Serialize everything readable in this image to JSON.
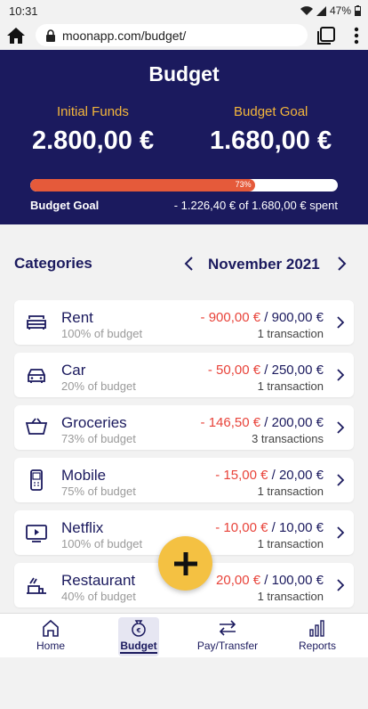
{
  "status": {
    "time": "10:31",
    "battery": "47%"
  },
  "browser": {
    "url": "moonapp.com/budget/"
  },
  "header": {
    "title": "Budget",
    "initial_funds_label": "Initial Funds",
    "initial_funds_value": "2.800,00 €",
    "budget_goal_label": "Budget Goal",
    "budget_goal_value": "1.680,00 €",
    "progress_fraction": 0.73,
    "progress_text": "73%",
    "goal_row_label": "Budget Goal",
    "goal_row_spent": "- 1.226,40 € of 1.680,00 € spent",
    "accent_color": "#f4b63b",
    "bar_color": "#e55a3a",
    "bg_color": "#1b1a5e"
  },
  "categories_section": {
    "heading": "Categories",
    "month": "November 2021"
  },
  "categories": [
    {
      "icon": "sofa-icon",
      "name": "Rent",
      "sub": "100% of budget",
      "spent": "- 900,00 €",
      "total": " / 900,00 €",
      "tx": "1 transaction"
    },
    {
      "icon": "car-icon",
      "name": "Car",
      "sub": "20% of budget",
      "spent": "- 50,00 €",
      "total": " / 250,00 €",
      "tx": "1 transaction"
    },
    {
      "icon": "basket-icon",
      "name": "Groceries",
      "sub": "73% of budget",
      "spent": "- 146,50 €",
      "total": " / 200,00 €",
      "tx": "3 transactions"
    },
    {
      "icon": "mobile-icon",
      "name": "Mobile",
      "sub": "75% of budget",
      "spent": "- 15,00 €",
      "total": " / 20,00 €",
      "tx": "1 transaction"
    },
    {
      "icon": "tv-icon",
      "name": "Netflix",
      "sub": "100% of budget",
      "spent": "- 10,00 €",
      "total": " / 10,00 €",
      "tx": "1 transaction"
    },
    {
      "icon": "restaurant-icon",
      "name": "Restaurant",
      "sub": "40% of budget",
      "spent": "20,00 €",
      "total": " / 100,00 €",
      "tx": "1 transaction"
    }
  ],
  "nav": {
    "home": "Home",
    "budget": "Budget",
    "pay": "Pay/Transfer",
    "reports": "Reports"
  }
}
